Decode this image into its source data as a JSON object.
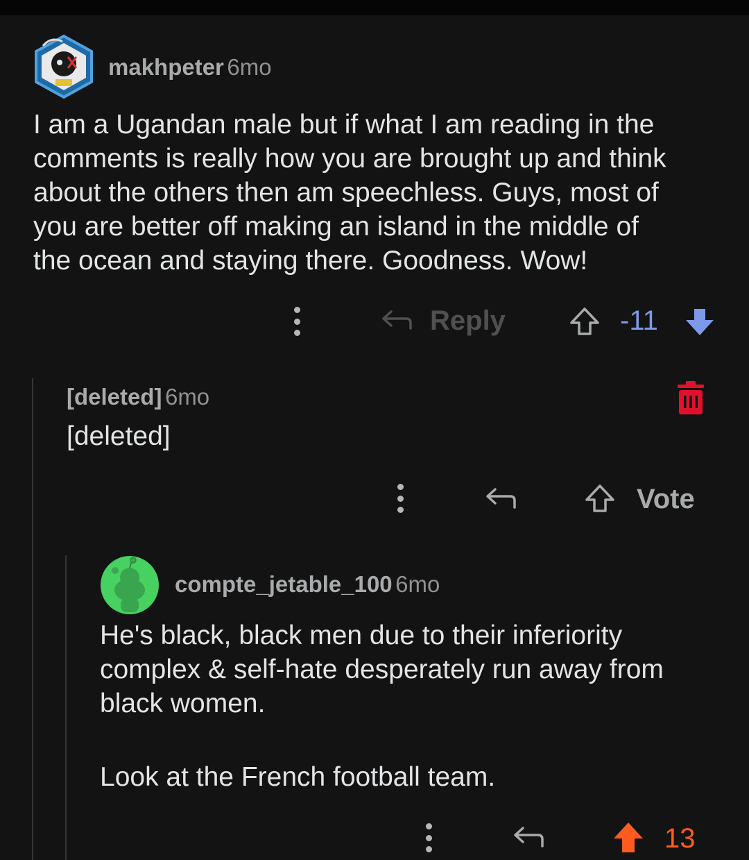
{
  "comments": [
    {
      "username": "makhpeter",
      "age": "6mo",
      "body": [
        "I am a Ugandan male but if what I am reading in the",
        "comments is really how you are brought up and think",
        "about the others then am speechless. Guys, most of",
        "you are better off making an island in the middle of",
        "the ocean and staying there. Goodness. Wow!"
      ],
      "reply_label": "Reply",
      "score": "-11",
      "vote_state": "downvoted"
    },
    {
      "username": "[deleted]",
      "age": "6mo",
      "body": "[deleted]",
      "vote_label": "Vote"
    },
    {
      "username": "compte_jetable_100",
      "age": "6mo",
      "body": [
        "He's black, black men due to their inferiority",
        "complex & self-hate desperately run away from",
        "black women."
      ],
      "body2": "Look at the French football team.",
      "score": "13",
      "vote_state": "upvoted"
    }
  ],
  "colors": {
    "background": "#131313",
    "downvote": "#7d9ae8",
    "upvote": "#ff5b1f",
    "delete": "#e0122b",
    "avatar_green": "#46d160"
  },
  "icons": [
    "more-options-icon",
    "reply-arrow-icon",
    "upvote-icon",
    "downvote-icon",
    "trash-icon",
    "snoo-avatar-icon"
  ]
}
